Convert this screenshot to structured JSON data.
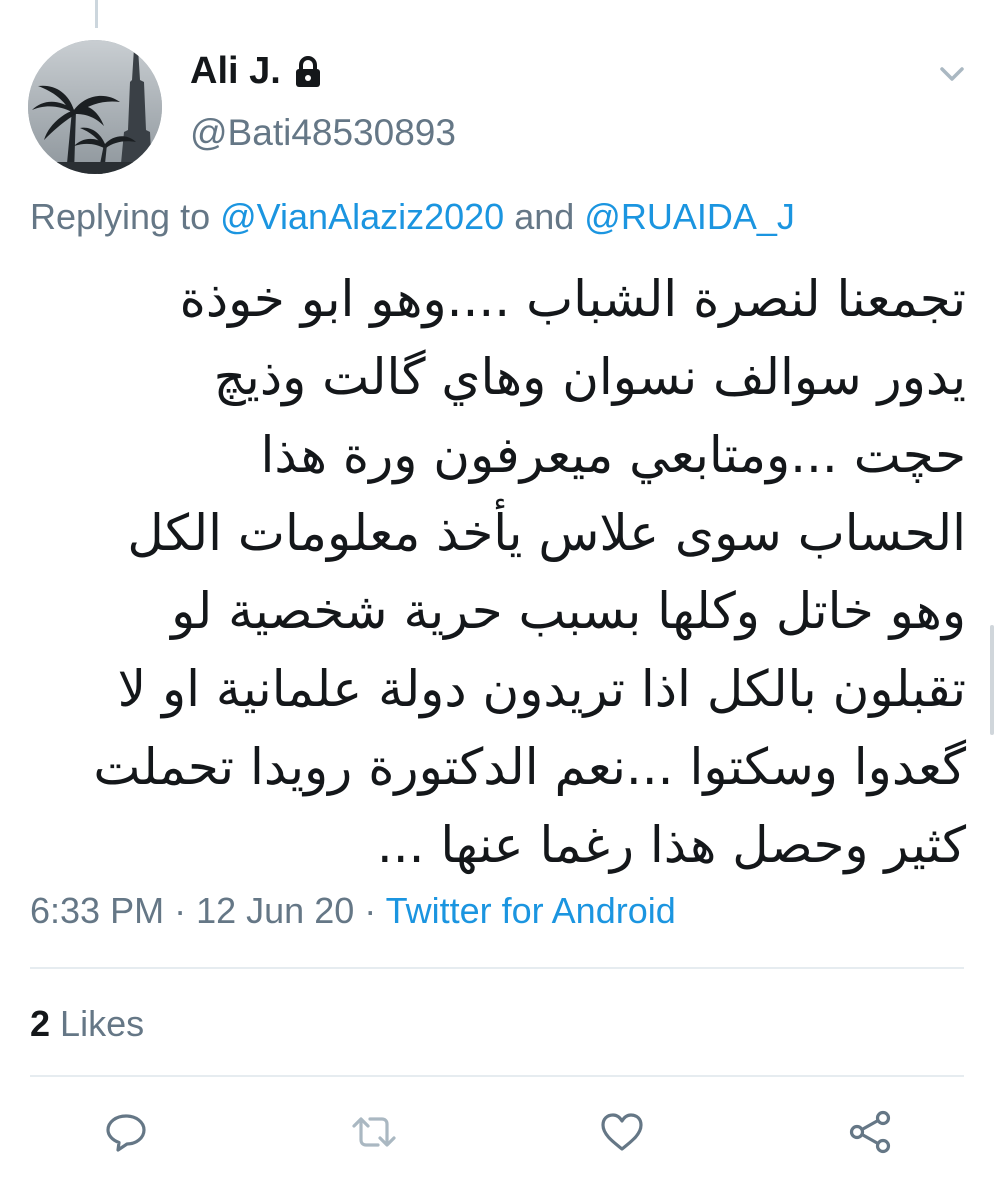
{
  "tweet": {
    "author": {
      "display_name": "Ali J.",
      "handle": "@Bati48530893",
      "protected_icon": "lock-icon",
      "avatar_icon": "avatar"
    },
    "menu_icon": "chevron-down-icon",
    "replying": {
      "prefix": "Replying to",
      "mention_1": "@VianAlaziz2020",
      "conjunction": "and",
      "mention_2": "@RUAIDA_J"
    },
    "text_lines": [
      "تجمعنا لنصرة الشباب ....وهو ابو خوذة",
      "يدور سوالف نسوان وهاي گالت وذيچ",
      "حچت ...ومتابعي ميعرفون ورة هذا",
      "الحساب سوى علاس يأخذ معلومات الكل",
      "وهو خاتل وكلها بسبب حرية شخصية لو",
      "تقبلون بالكل اذا تريدون دولة علمانية او لا",
      "گعدوا وسكتوا ...نعم الدكتورة رويدا تحملت",
      "كثير وحصل هذا رغما عنها ..."
    ],
    "time": "6:33 PM",
    "date": "12 Jun 20",
    "separator": "·",
    "source": "Twitter for Android",
    "likes_count": "2",
    "likes_label": "Likes",
    "actions": [
      "reply-icon",
      "retweet-icon",
      "like-icon",
      "share-icon"
    ],
    "colors": {
      "text": "#14171a",
      "secondary": "#657786",
      "link": "#1b95e0",
      "divider": "#e6ecf0"
    }
  }
}
